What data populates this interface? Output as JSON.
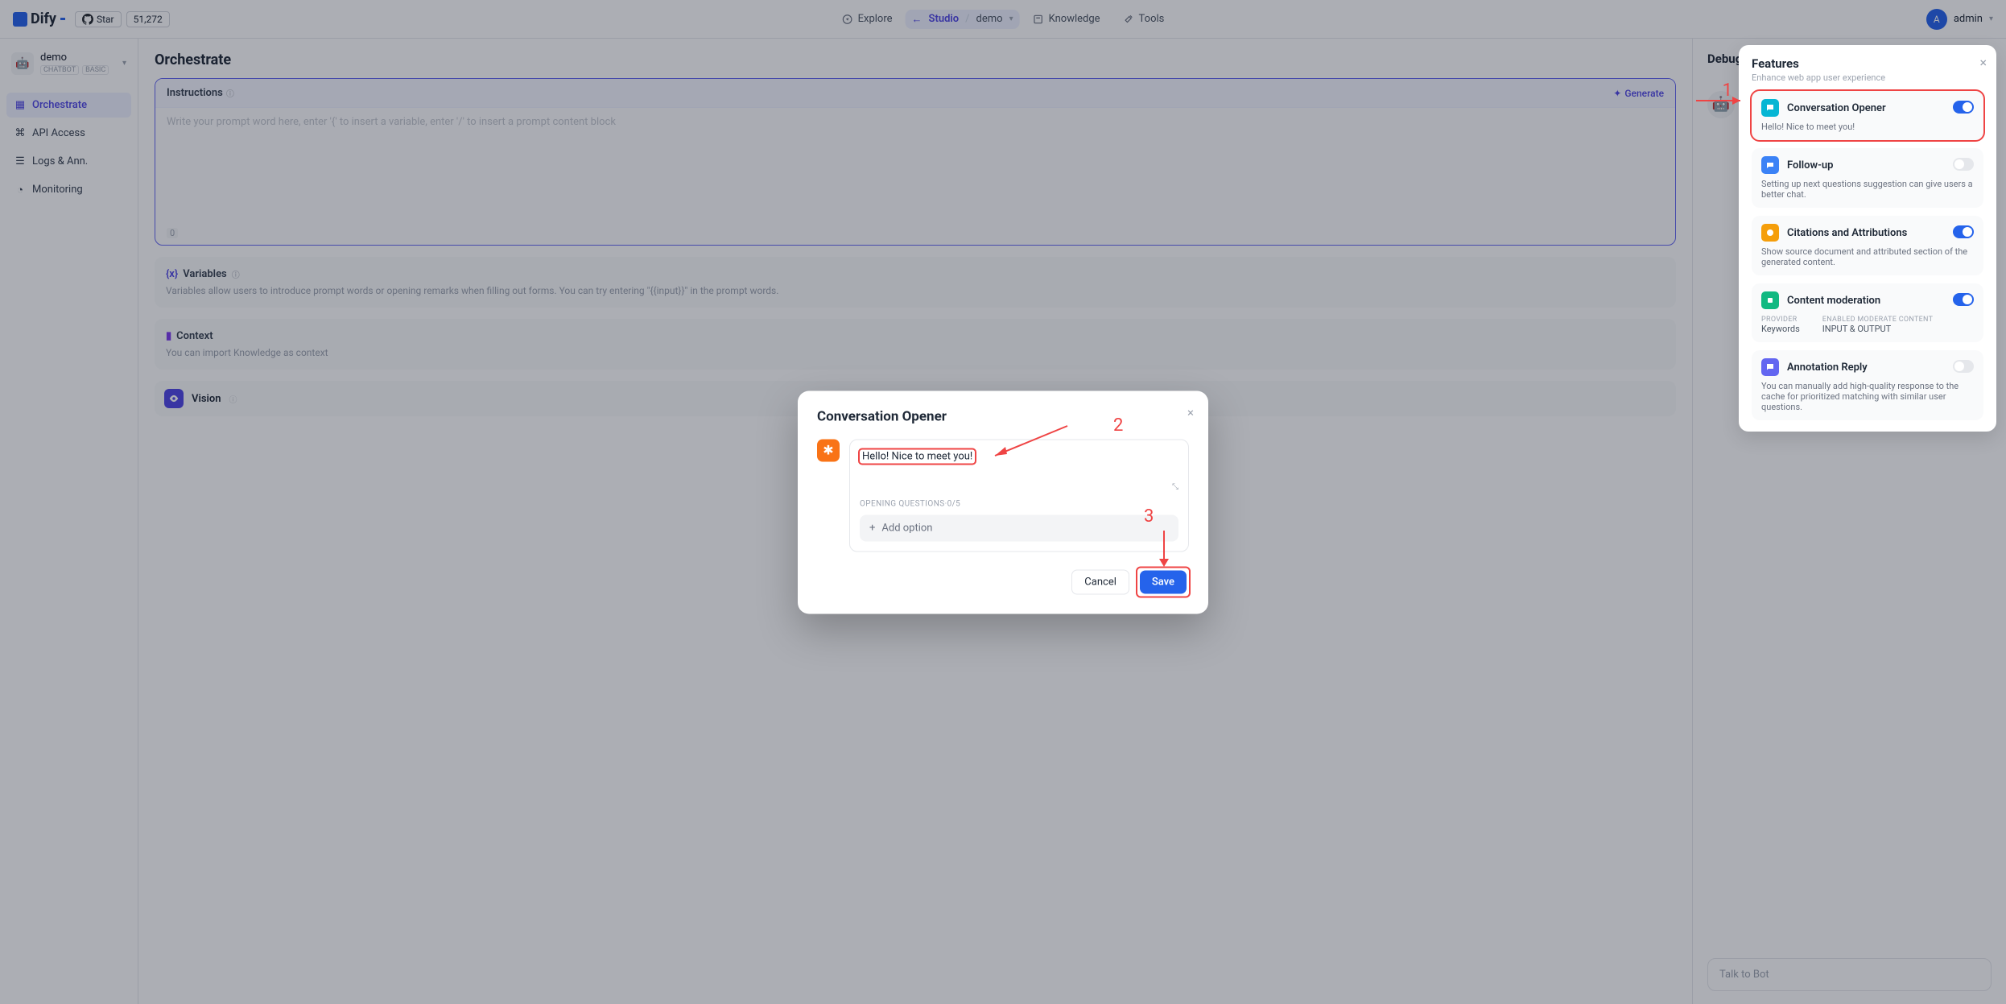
{
  "topnav": {
    "logo": "Dify",
    "github_star": "Star",
    "github_count": "51,272",
    "explore": "Explore",
    "studio": "Studio",
    "demo": "demo",
    "knowledge": "Knowledge",
    "tools": "Tools",
    "user_initial": "A",
    "user_name": "admin"
  },
  "sidebar": {
    "app_name": "demo",
    "tag_chatbot": "CHATBOT",
    "tag_basic": "BASIC",
    "nav": {
      "orchestrate": "Orchestrate",
      "api": "API Access",
      "logs": "Logs & Ann.",
      "monitoring": "Monitoring"
    }
  },
  "editor": {
    "page_title": "Orchestrate",
    "instructions_label": "Instructions",
    "generate": "Generate",
    "placeholder": "Write your prompt word here, enter '{' to insert a variable, enter '/' to insert a prompt content block",
    "counter": "0",
    "variables_title": "Variables",
    "variables_desc": "Variables allow users to introduce prompt words or opening remarks when filling out forms. You can try entering \"{{input}}\" in the prompt words.",
    "context_title": "Context",
    "context_desc": "You can import Knowledge as context",
    "vision_title": "Vision"
  },
  "preview": {
    "title": "Debug & Preview",
    "greeting": "Hello! Nice to meet you!",
    "talk_placeholder": "Talk to Bot"
  },
  "features": {
    "title": "Features",
    "subtitle": "Enhance web app user experience",
    "conv_opener": {
      "title": "Conversation Opener",
      "desc": "Hello! Nice to meet you!"
    },
    "followup": {
      "title": "Follow-up",
      "desc": "Setting up next questions suggestion can give users a better chat."
    },
    "citations": {
      "title": "Citations and Attributions",
      "desc": "Show source document and attributed section of the generated content."
    },
    "moderation": {
      "title": "Content moderation",
      "provider_k": "PROVIDER",
      "provider_v": "Keywords",
      "enabled_k": "ENABLED MODERATE CONTENT",
      "enabled_v": "INPUT & OUTPUT"
    },
    "annotation": {
      "title": "Annotation Reply",
      "desc": "You can manually add high-quality response to the cache for prioritized matching with similar user questions."
    }
  },
  "modal": {
    "title": "Conversation Opener",
    "opener_text": "Hello! Nice to meet you!",
    "oq_label": "OPENING QUESTIONS·0/5",
    "add_option": "Add option",
    "cancel": "Cancel",
    "save": "Save"
  },
  "annotations": {
    "n1": "1",
    "n2": "2",
    "n3": "3"
  }
}
